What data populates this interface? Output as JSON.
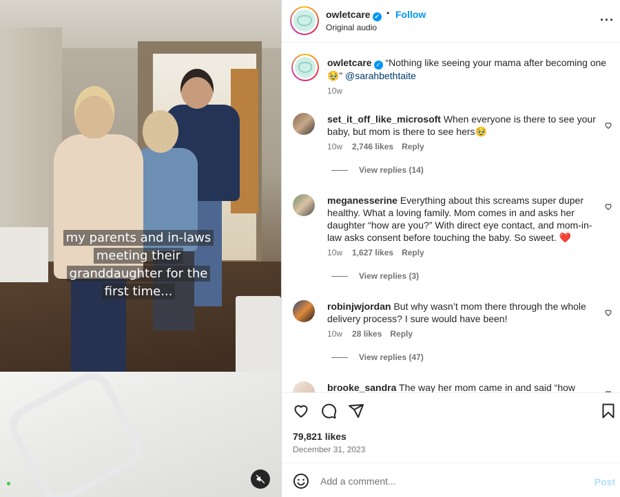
{
  "video": {
    "caption_lines": [
      "my parents and in-laws",
      "meeting their",
      "granddaughter for the",
      "first time..."
    ],
    "mute_icon": "speaker-muted-icon"
  },
  "header": {
    "username": "owletcare",
    "separator": "•",
    "follow_label": "Follow",
    "audio_label": "Original audio",
    "more_icon": "more-horizontal-icon"
  },
  "post_caption": {
    "username": "owletcare",
    "text": "“Nothing like seeing your mama after becoming one 🥹” ",
    "mention": "@sarahbethtaite",
    "time": "10w"
  },
  "comments": [
    {
      "username": "set_it_off_like_microsoft",
      "text": "When everyone is there to see your baby, but mom is there to see hers🥹",
      "time": "10w",
      "likes": "2,746 likes",
      "reply_label": "Reply",
      "view_replies": "View replies (14)"
    },
    {
      "username": "meganesserine",
      "text": "Everything about this screams super duper healthy. What a loving family. Mom comes in and asks her daughter “how are you?” With direct eye contact, and mom-in-law asks consent before touching the baby. So sweet. ❤️",
      "time": "10w",
      "likes": "1,627 likes",
      "reply_label": "Reply",
      "view_replies": "View replies (3)"
    },
    {
      "username": "robinjwjordan",
      "text": "But why wasn’t mom there through the whole delivery process? I sure would have been!",
      "time": "10w",
      "likes": "28 likes",
      "reply_label": "Reply",
      "view_replies": "View replies (47)"
    },
    {
      "username": "brooke_sandra",
      "text": "The way her mom came in and said “how",
      "time": "",
      "likes": "",
      "reply_label": "",
      "view_replies": ""
    }
  ],
  "actions": {
    "like_icon": "heart-icon",
    "comment_icon": "comment-bubble-icon",
    "share_icon": "paper-plane-icon",
    "save_icon": "bookmark-icon",
    "likes_count": "79,821 likes",
    "date": "December 31, 2023"
  },
  "add_comment": {
    "placeholder": "Add a comment...",
    "post_label": "Post",
    "emoji_icon": "smiley-icon"
  },
  "colors": {
    "accent": "#0095f6",
    "text": "#262626",
    "muted": "#737373",
    "post_disabled": "#b2dffc",
    "heart_red": "#ed4956"
  }
}
